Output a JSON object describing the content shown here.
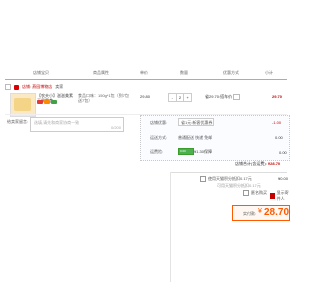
{
  "header": {
    "columns": [
      "店铺宝贝",
      "商品属性",
      "单价",
      "数量",
      "优惠方式",
      "小计"
    ]
  },
  "shop": {
    "name": "店铺: 燕园博物店",
    "tag": "卖家"
  },
  "item": {
    "title": "【农夫小】滋滋美素干果零食...",
    "spec": "食品口味：150g*1包（到7包送7包）",
    "price": "29.80",
    "qty": "2",
    "minus": "-",
    "plus": "+",
    "promo": "省29.70:搭车价",
    "subtotal": "29.70"
  },
  "message": {
    "label": "给卖家留言:",
    "placeholder": "选填,请先和商家协商一致",
    "counter": "0/200"
  },
  "coupon": {
    "label": "店铺优惠:",
    "selected": "省1元:新客优惠券",
    "value": "-1.00"
  },
  "shipping": {
    "label": "运送方式:",
    "selected": "普通配送 快递 免邮",
    "value": "0.00"
  },
  "jifen": {
    "label": "运费险:",
    "badge": "0.00",
    "note": "¥1.30保障",
    "value": "0.00"
  },
  "total": {
    "label": "店铺合计(含运费):",
    "value": "¥28.70"
  },
  "options": {
    "opt1": "使用天猫积分抵扣0.17元",
    "opt1_value": "¥0.00",
    "opt2": "可用天猫积分抵扣0.17元",
    "opt3": "匿名购买",
    "opt4": "显示寄件人"
  },
  "pay": {
    "label": "实付款:",
    "currency": "¥",
    "amount": "28.70"
  },
  "colors": {
    "accent": "#ff5a00",
    "price_red": "#c40000",
    "header_line": "#8ab4d8"
  }
}
